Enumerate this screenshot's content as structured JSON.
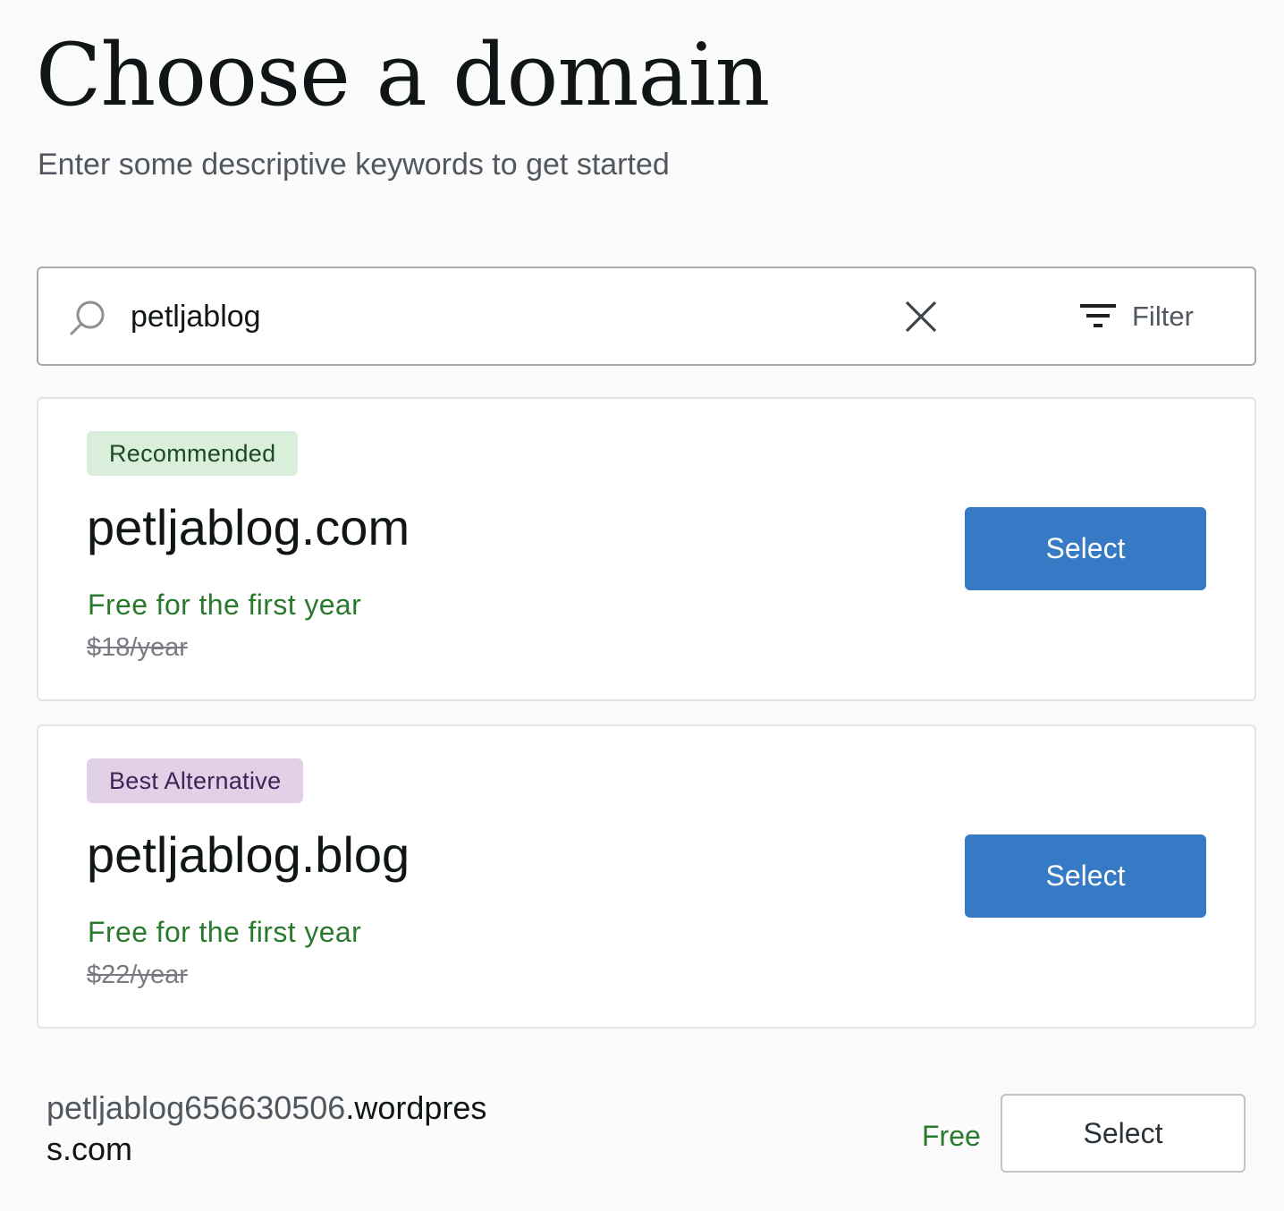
{
  "header": {
    "title": "Choose a domain",
    "subtitle": "Enter some descriptive keywords to get started"
  },
  "search": {
    "value": "petljablog",
    "icon": "search-icon",
    "clear_icon": "close-icon",
    "filter_icon": "filter-icon",
    "filter_label": "Filter"
  },
  "suggestions": [
    {
      "badge": "Recommended",
      "badge_color": "#d9eedb",
      "domain": "petljablog.com",
      "free_text": "Free for the first year",
      "original_price": "$18/year",
      "select_label": "Select"
    },
    {
      "badge": "Best Alternative",
      "badge_color": "#e2d0e6",
      "domain": "petljablog.blog",
      "free_text": "Free for the first year",
      "original_price": "$22/year",
      "select_label": "Select"
    }
  ],
  "free_option": {
    "subdomain": "petljablog656630506",
    "suffix": ".wordpress.com",
    "price": "Free",
    "select_label": "Select"
  },
  "colors": {
    "primary_button": "#3679c4",
    "price_green": "#2a7a2e",
    "page_background": "#fbfbfb"
  }
}
